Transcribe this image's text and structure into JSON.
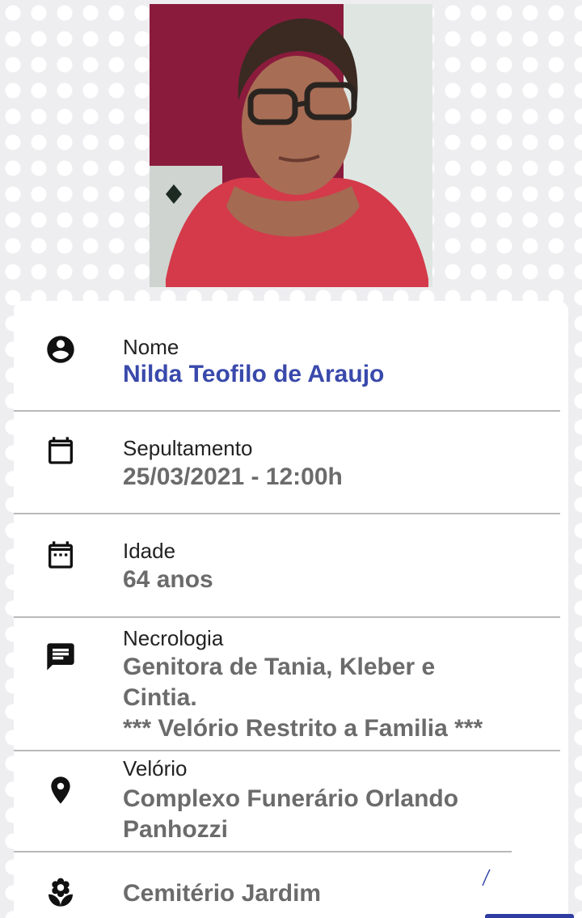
{
  "photo": {
    "alt": "Nilda Teofilo de Araujo"
  },
  "rows": [
    {
      "icon": "account-circle-icon",
      "label": "Nome",
      "value": "Nilda Teofilo de Araujo"
    },
    {
      "icon": "calendar-icon",
      "label": "Sepultamento",
      "value": "25/03/2021 - 12:00h"
    },
    {
      "icon": "calendar-days-icon",
      "label": "Idade",
      "value": "64 anos"
    },
    {
      "icon": "message-icon",
      "label": "Necrologia",
      "value_lines": [
        "Genitora de Tania, Kleber e",
        "Cintia.",
        "*** Velório Restrito a Familia ***"
      ]
    },
    {
      "icon": "location-pin-icon",
      "label": "Velório",
      "value_lines": [
        "Complexo Funerário Orlando",
        "Panhozzi"
      ]
    },
    {
      "icon": "flower-icon",
      "value": "Cemitério Jardim"
    }
  ],
  "colors": {
    "accent": "#3949ab",
    "value_gray": "#6b6b6b",
    "divider": "#b9b9b9"
  }
}
